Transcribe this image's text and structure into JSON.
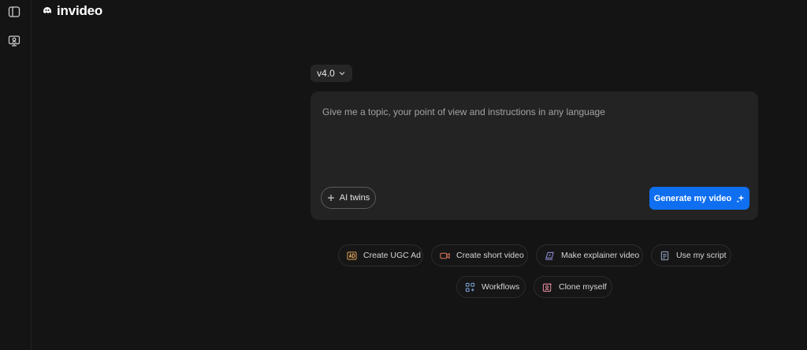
{
  "app": {
    "logo_text": "invideo"
  },
  "rail": {
    "toggle_icon": "sidebar-toggle-icon",
    "monitor_icon": "monitor-icon"
  },
  "version": {
    "label": "v4.0"
  },
  "prompt": {
    "placeholder": "Give me a topic, your point of view and instructions in any language",
    "value": ""
  },
  "ai_twins": {
    "label": "AI twins"
  },
  "generate": {
    "label": "Generate my video"
  },
  "actions": [
    {
      "label": "Create UGC Ad",
      "icon": "ad-icon",
      "color": "#d9a05b"
    },
    {
      "label": "Create short video",
      "icon": "video-camera-icon",
      "color": "#e07a5f"
    },
    {
      "label": "Make explainer video",
      "icon": "explainer-icon",
      "color": "#8f8fd6"
    },
    {
      "label": "Use my script",
      "icon": "document-icon",
      "color": "#9aa7c7"
    },
    {
      "label": "Workflows",
      "icon": "workflows-icon",
      "color": "#7fa6d9"
    },
    {
      "label": "Clone myself",
      "icon": "clone-icon",
      "color": "#e58aa0"
    }
  ],
  "colors": {
    "accent": "#0f6ff0",
    "background": "#141414",
    "card": "#232323"
  }
}
